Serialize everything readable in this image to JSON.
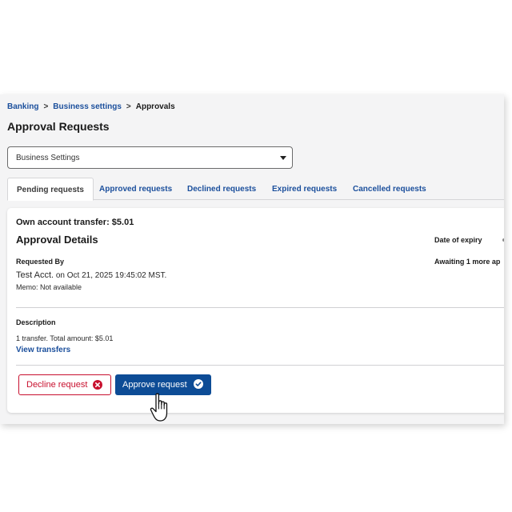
{
  "breadcrumb": {
    "items": [
      "Banking",
      "Business settings"
    ],
    "separator": ">",
    "current": "Approvals"
  },
  "page": {
    "title": "Approval Requests"
  },
  "account_select": {
    "value": "Business Settings"
  },
  "tabs": [
    {
      "label": "Pending requests",
      "active": true
    },
    {
      "label": "Approved requests",
      "active": false
    },
    {
      "label": "Declined requests",
      "active": false
    },
    {
      "label": "Expired requests",
      "active": false
    },
    {
      "label": "Cancelled requests",
      "active": false
    }
  ],
  "request": {
    "title": "Own account transfer: $5.01",
    "details_heading": "Approval Details",
    "expiry_label": "Date of expiry",
    "status_text": "Awaiting 1 more ap",
    "requested_by_label": "Requested By",
    "requester_name": "Test Acct.",
    "requested_on": "on Oct 21, 2025 19:45:02 MST.",
    "memo": "Memo: Not available",
    "description_label": "Description",
    "description": "1 transfer. Total amount: $5.01",
    "view_transfers_link": "View transfers"
  },
  "actions": {
    "decline_label": "Decline request",
    "approve_label": "Approve request"
  },
  "icons": {
    "decline": "x-circle-icon",
    "approve": "check-circle-icon",
    "cursor": "hand-pointer-icon",
    "dropdown": "caret-down-icon"
  },
  "colors": {
    "link": "#1b4f9c",
    "primary": "#0d4c96",
    "danger": "#c8102e"
  }
}
